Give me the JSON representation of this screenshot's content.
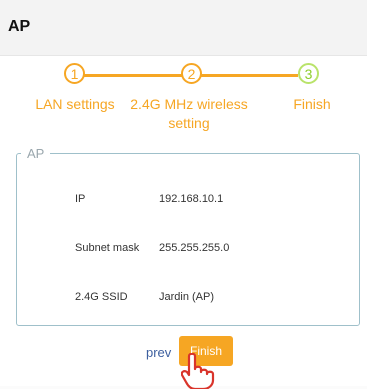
{
  "header": {
    "title": "AP"
  },
  "stepper": {
    "steps": [
      {
        "number": "1",
        "label": "LAN settings"
      },
      {
        "number": "2",
        "label_line1": "2.4G MHz wireless",
        "label_line2": "setting"
      },
      {
        "number": "3",
        "label": "Finish"
      }
    ]
  },
  "ap_box": {
    "legend": "AP",
    "rows": [
      {
        "label": "IP",
        "value": "192.168.10.1"
      },
      {
        "label": "Subnet mask",
        "value": "255.255.255.0"
      },
      {
        "label": "2.4G SSID",
        "value": "Jardin (AP)"
      }
    ]
  },
  "actions": {
    "prev_label": "prev",
    "finish_label": "Finish"
  },
  "colors": {
    "accent": "#f6a623",
    "completed_step": "#8ccd2a",
    "box_border": "#9fc0ca",
    "link": "#3d5f9f"
  }
}
